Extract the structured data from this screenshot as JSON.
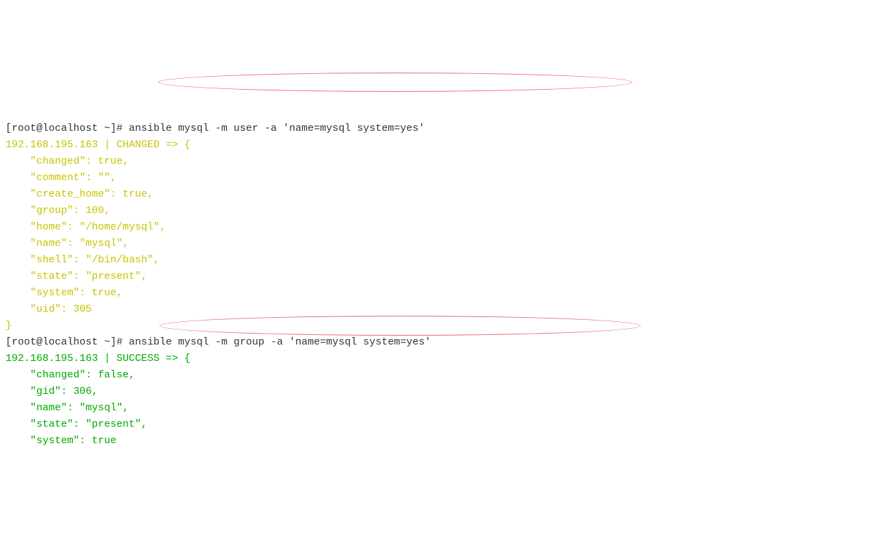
{
  "block1": {
    "prompt": "[root@localhost ~]# ",
    "command": "ansible mysql -m user -a 'name=mysql system=yes'",
    "header": "192.168.195.163 | CHANGED => {",
    "lines": {
      "l1": "    \"changed\": true,",
      "l2": "    \"comment\": \"\",",
      "l3": "    \"create_home\": true,",
      "l4": "    \"group\": 100,",
      "l5": "    \"home\": \"/home/mysql\",",
      "l6": "    \"name\": \"mysql\",",
      "l7": "    \"shell\": \"/bin/bash\",",
      "l8": "    \"state\": \"present\",",
      "l9": "    \"system\": true,",
      "l10": "    \"uid\": 305"
    },
    "close": "}"
  },
  "block2": {
    "prompt": "[root@localhost ~]# ",
    "command": "ansible mysql -m group -a 'name=mysql system=yes'",
    "header": "192.168.195.163 | SUCCESS => {",
    "lines": {
      "l1": "    \"changed\": false,",
      "l2": "    \"gid\": 306,",
      "l3": "    \"name\": \"mysql\",",
      "l4": "    \"state\": \"present\",",
      "l5": "    \"system\": true"
    }
  }
}
